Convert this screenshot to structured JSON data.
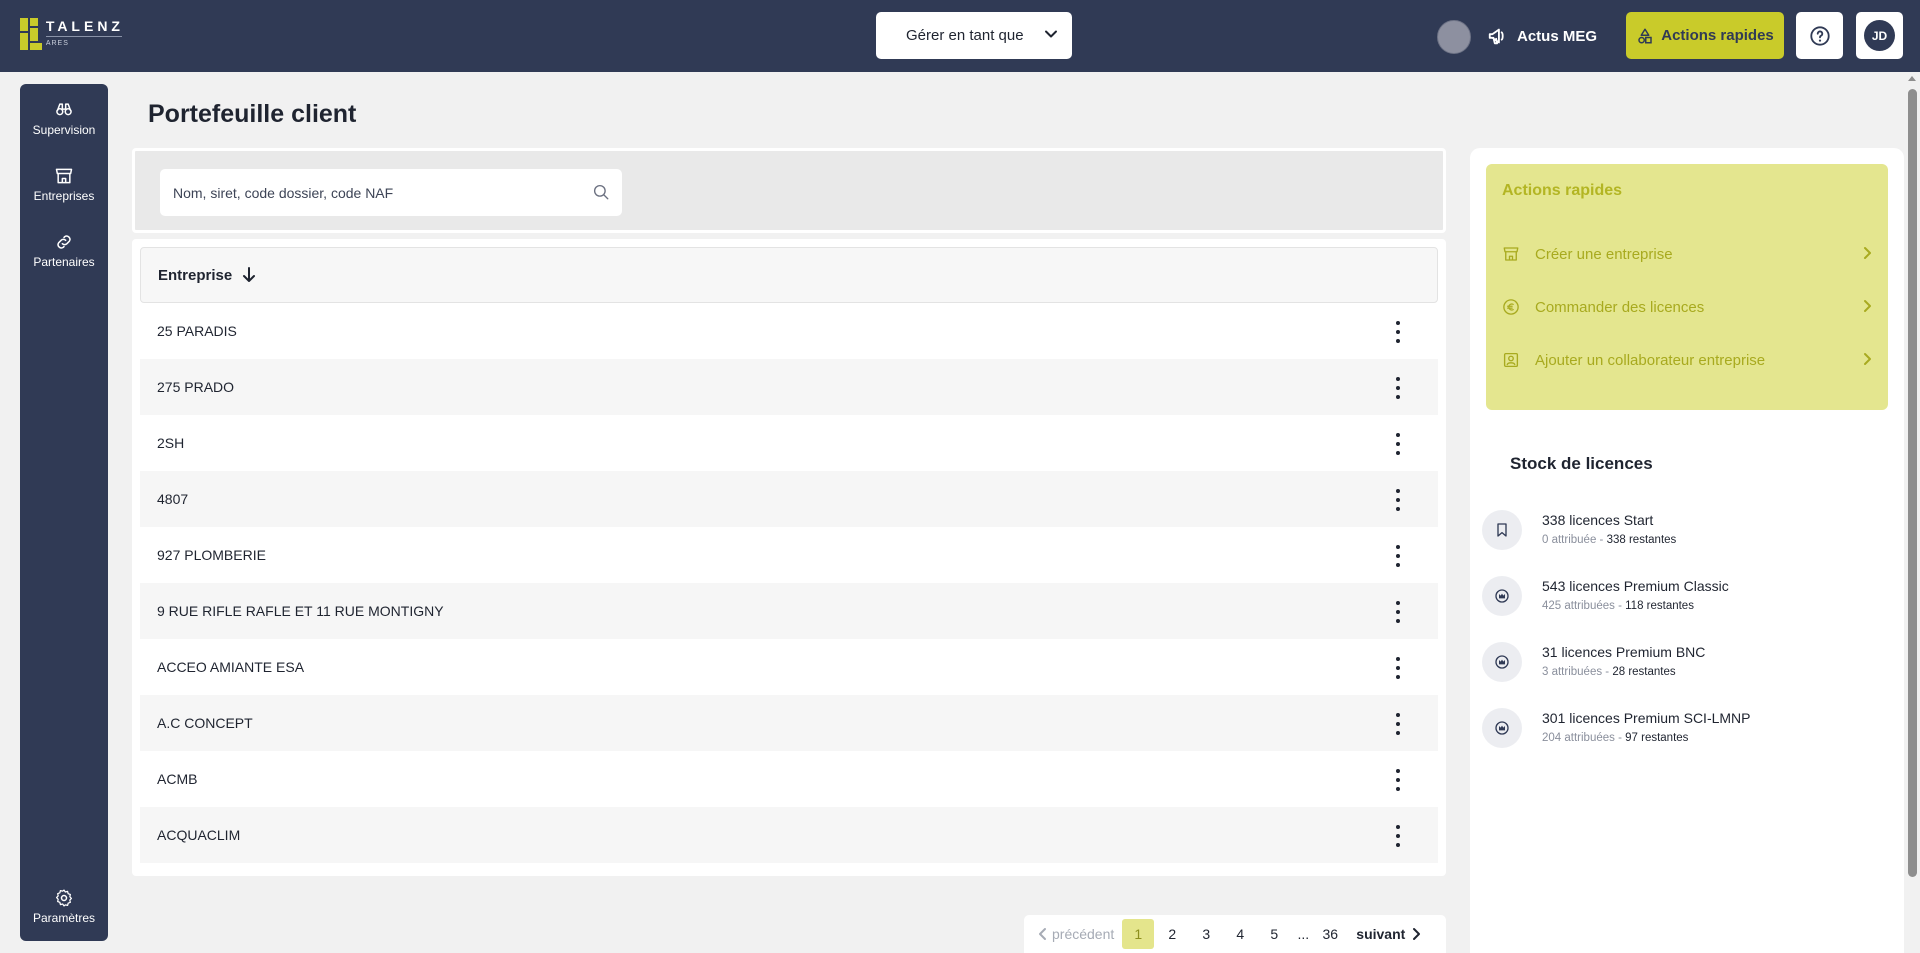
{
  "brand": {
    "name": "TALENZ",
    "sub": "ARES",
    "accent": "#c9cb2a",
    "navy": "#303a55"
  },
  "header": {
    "manage_label": "Gérer en tant que",
    "news_label": "Actus MEG",
    "quick_actions_label": "Actions rapides",
    "avatar_initials": "JD"
  },
  "sidebar": {
    "items": [
      {
        "label": "Supervision",
        "icon": "binoculars-icon"
      },
      {
        "label": "Entreprises",
        "icon": "storefront-icon"
      },
      {
        "label": "Partenaires",
        "icon": "link-icon"
      }
    ],
    "settings_label": "Paramètres"
  },
  "main": {
    "title": "Portefeuille client",
    "search": {
      "placeholder": "Nom, siret, code dossier, code NAF",
      "value": ""
    },
    "table": {
      "column": "Entreprise",
      "sort": "descending",
      "rows": [
        "25 PARADIS",
        "275 PRADO",
        "2SH",
        "4807",
        "927 PLOMBERIE",
        "9 RUE RIFLE RAFLE ET 11 RUE MONTIGNY",
        "ACCEO AMIANTE ESA",
        "A.C CONCEPT",
        "ACMB",
        "ACQUACLIM"
      ]
    },
    "pagination": {
      "prev": "précédent",
      "pages": [
        "1",
        "2",
        "3",
        "4",
        "5"
      ],
      "dots": "...",
      "last": "36",
      "next": "suivant",
      "current": "1"
    }
  },
  "right": {
    "quick": {
      "title": "Actions rapides",
      "items": [
        {
          "label": "Créer une entreprise",
          "icon": "storefront-icon"
        },
        {
          "label": "Commander des licences",
          "icon": "euro-icon"
        },
        {
          "label": "Ajouter un collaborateur entreprise",
          "icon": "user-badge-icon"
        }
      ]
    },
    "stock": {
      "title": "Stock de licences",
      "items": [
        {
          "name": "338 licences Start",
          "assigned": "0 attribuée",
          "sep": " - ",
          "remaining": "338 restantes",
          "icon": "bookmark-icon"
        },
        {
          "name": "543 licences Premium Classic",
          "assigned": "425 attribuées",
          "sep": " - ",
          "remaining": "118 restantes",
          "icon": "crown-icon"
        },
        {
          "name": "31 licences Premium BNC",
          "assigned": "3 attribuées",
          "sep": " - ",
          "remaining": "28 restantes",
          "icon": "crown-icon"
        },
        {
          "name": "301 licences Premium SCI-LMNP",
          "assigned": "204 attribuées",
          "sep": " - ",
          "remaining": "97 restantes",
          "icon": "crown-icon"
        }
      ]
    }
  }
}
